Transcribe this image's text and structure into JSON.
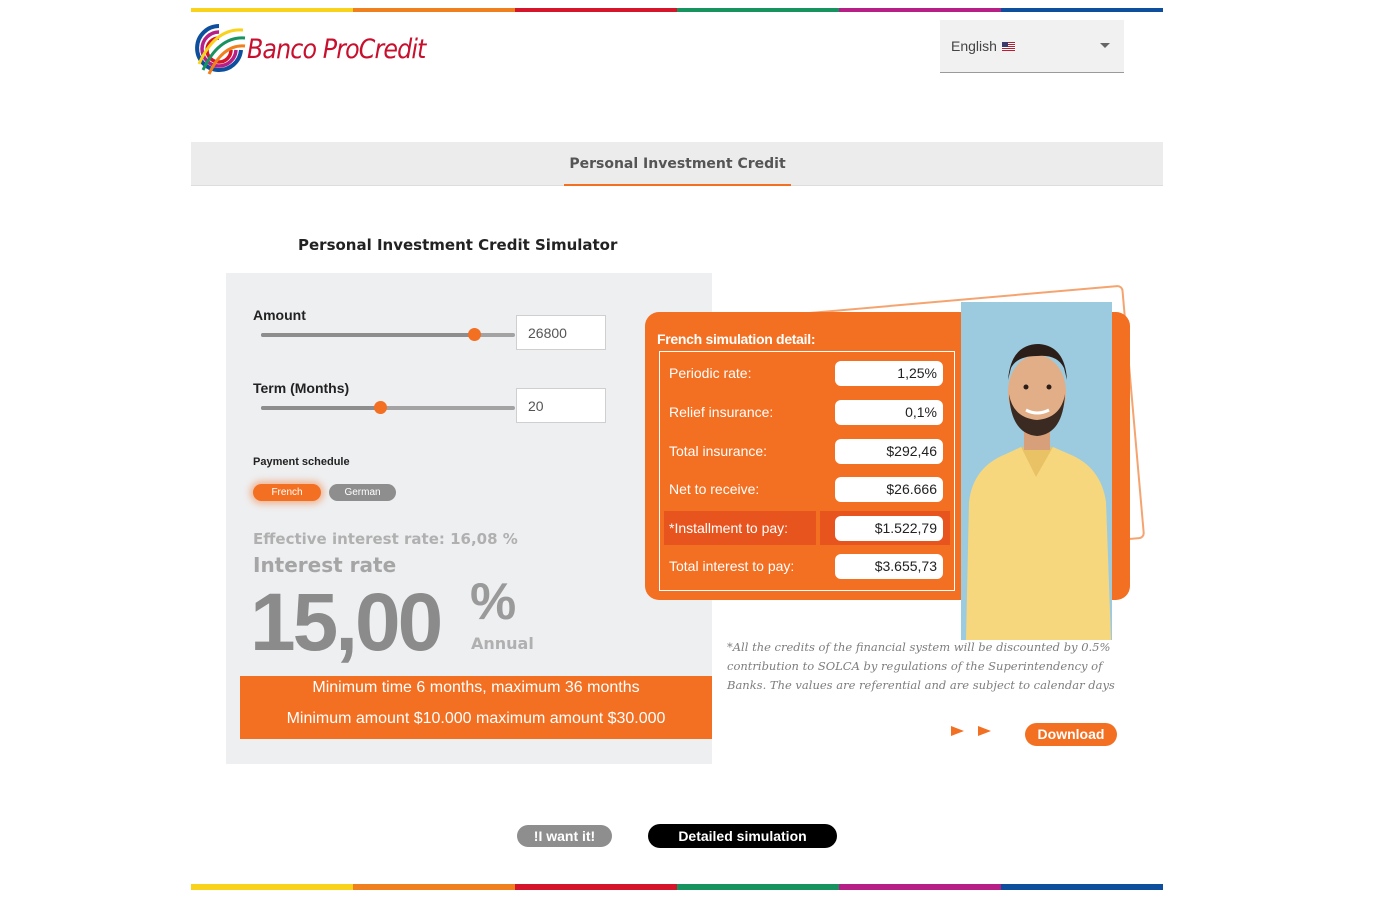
{
  "brand": {
    "name": "Banco ProCredit"
  },
  "language_selector": {
    "value": "English",
    "flag_icon": "us-flag-icon"
  },
  "nav": {
    "tab_label": "Personal Investment Credit"
  },
  "simulator": {
    "title": "Personal Investment Credit Simulator",
    "amount": {
      "label": "Amount",
      "value": "26800",
      "min": 10000,
      "max": 30000,
      "fraction": 0.84
    },
    "term": {
      "label": "Term (Months)",
      "value": "20",
      "min": 6,
      "max": 36,
      "fraction": 0.47
    },
    "payment_schedule": {
      "label": "Payment schedule",
      "options": [
        "French",
        "German"
      ],
      "selected": "French"
    },
    "effective_rate": "Effective interest rate: 16,08 %",
    "interest_rate_label": "Interest rate",
    "interest_rate_value": "15,00",
    "interest_rate_symbol": "%",
    "interest_rate_period": "Annual",
    "limits": [
      "Minimum time 6 months, maximum 36 months",
      "Minimum amount $10.000 maximum amount $30.000"
    ]
  },
  "detail": {
    "title": "French simulation detail:",
    "rows": [
      {
        "label": "Periodic rate:",
        "value": "1,25%"
      },
      {
        "label": "Relief insurance:",
        "value": "0,1%"
      },
      {
        "label": "Total insurance:",
        "value": "$292,46"
      },
      {
        "label": "Net to receive:",
        "value": "$26.666"
      },
      {
        "label": "*Installment to pay:",
        "value": "$1.522,79"
      },
      {
        "label": "Total interest to pay:",
        "value": "$3.655,73"
      }
    ]
  },
  "disclaimer": "*All the credits of the financial system will be discounted by 0.5% contribution to SOLCA by regulations of the Superintendency of Banks. The values are referential and are subject to calendar days",
  "actions": {
    "download": "Download",
    "want_it": "!I want it!",
    "detailed_simulation": "Detailed simulation"
  },
  "colors": {
    "accent": "#f36f21",
    "brand_red": "#c8102e",
    "stripe": [
      "#f9d21c",
      "#f07f1d",
      "#d5152a",
      "#17935f",
      "#b51f86",
      "#0d4f9c"
    ]
  }
}
